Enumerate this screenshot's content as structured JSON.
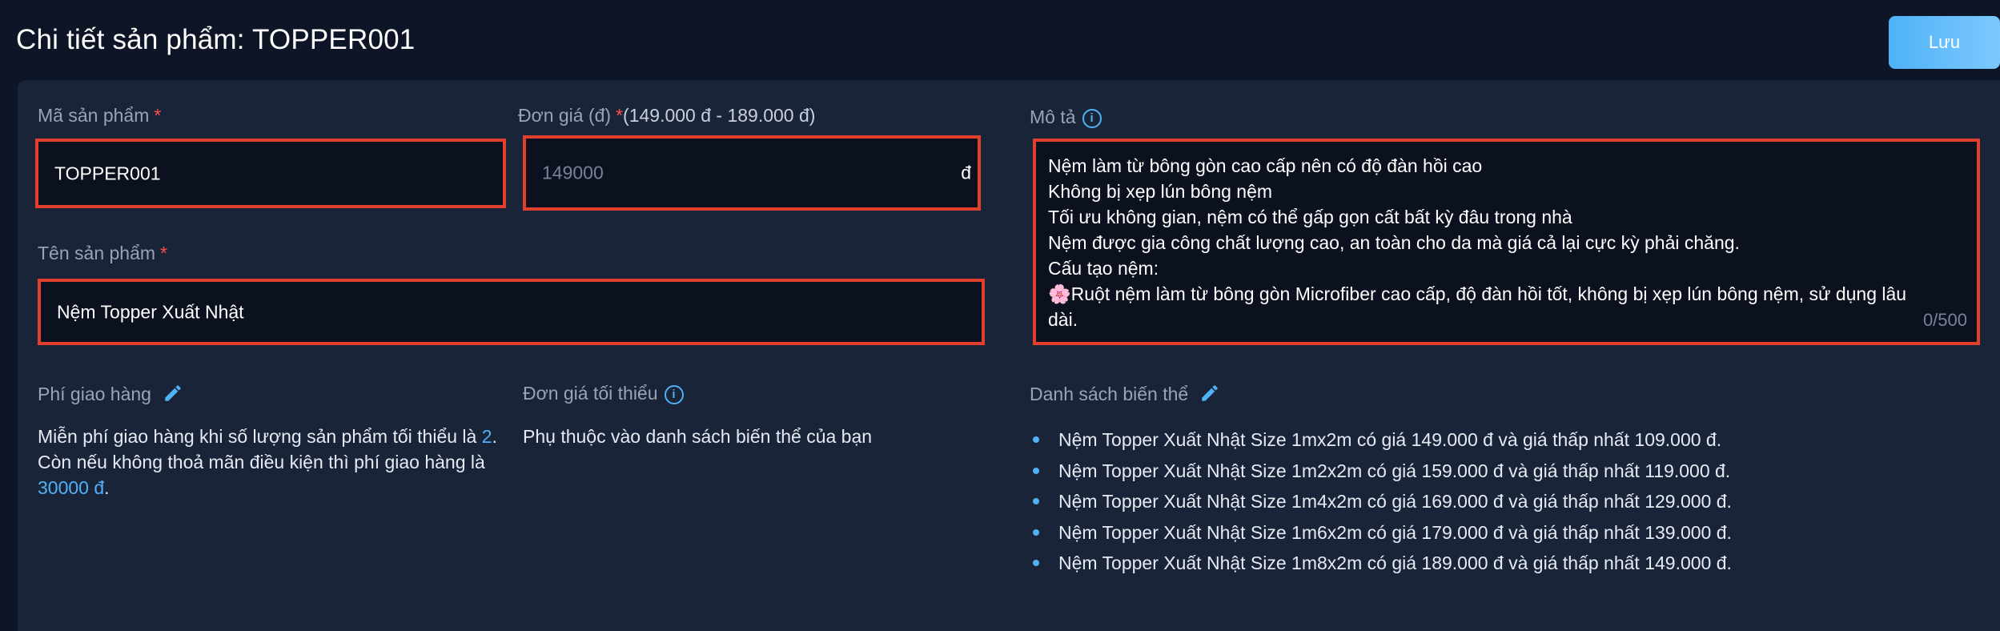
{
  "header": {
    "title": "Chi tiết sản phẩm: TOPPER001",
    "save_label": "Lưu"
  },
  "form": {
    "code": {
      "label": "Mã sản phẩm",
      "required": "*",
      "value": "TOPPER001"
    },
    "price": {
      "label": "Đơn giá (đ)",
      "required": "*",
      "range": "(149.000 đ - 189.000 đ)",
      "placeholder": "149000",
      "currency": "đ"
    },
    "name": {
      "label": "Tên sản phẩm",
      "required": "*",
      "value": "Nệm Topper Xuất Nhật"
    },
    "description": {
      "label": "Mô tả",
      "value": "Nệm làm từ bông gòn cao cấp nên có độ đàn hồi cao\nKhông bị xẹp lún bông nệm\nTối ưu không gian, nệm có thể gấp gọn cất bất kỳ đâu trong nhà\nNệm được gia công chất lượng cao, an toàn cho da mà giá cả lại cực kỳ phải chăng.\nCấu tạo nệm:\n🌸Ruột nệm làm từ bông gòn Microfiber cao cấp, độ đàn hồi tốt, không bị xẹp lún bông nệm, sử dụng lâu dài.",
      "counter": "0/500"
    }
  },
  "shipping": {
    "label": "Phí giao hàng",
    "line1_prefix": "Miễn phí giao hàng khi số lượng sản phẩm tối thiểu là ",
    "min_qty": "2",
    "line1_suffix": ".",
    "line2_prefix": "Còn nếu không thoả mãn điều kiện thì phí giao hàng là ",
    "fee": "30000 đ",
    "line2_suffix": "."
  },
  "min_price": {
    "label": "Đơn giá tối thiểu",
    "text": "Phụ thuộc vào danh sách biến thể của bạn"
  },
  "variants": {
    "label": "Danh sách biến thể",
    "items": [
      "Nệm Topper Xuất Nhật Size 1mx2m có giá 149.000 đ và giá thấp nhất 109.000 đ.",
      "Nệm Topper Xuất Nhật Size 1m2x2m có giá 159.000 đ và giá thấp nhất 119.000 đ.",
      "Nệm Topper Xuất Nhật Size 1m4x2m có giá 169.000 đ và giá thấp nhất 129.000 đ.",
      "Nệm Topper Xuất Nhật Size 1m6x2m có giá 179.000 đ và giá thấp nhất 139.000 đ.",
      "Nệm Topper Xuất Nhật Size 1m8x2m có giá 189.000 đ và giá thấp nhất 149.000 đ."
    ]
  },
  "icons": {
    "info": "info-icon",
    "edit": "pencil-icon"
  },
  "colors": {
    "accent": "#4fb2f6",
    "required": "#ff4d4f",
    "highlight_border": "#e2402c",
    "background": "#0e1526",
    "panel": "#1a2438"
  }
}
